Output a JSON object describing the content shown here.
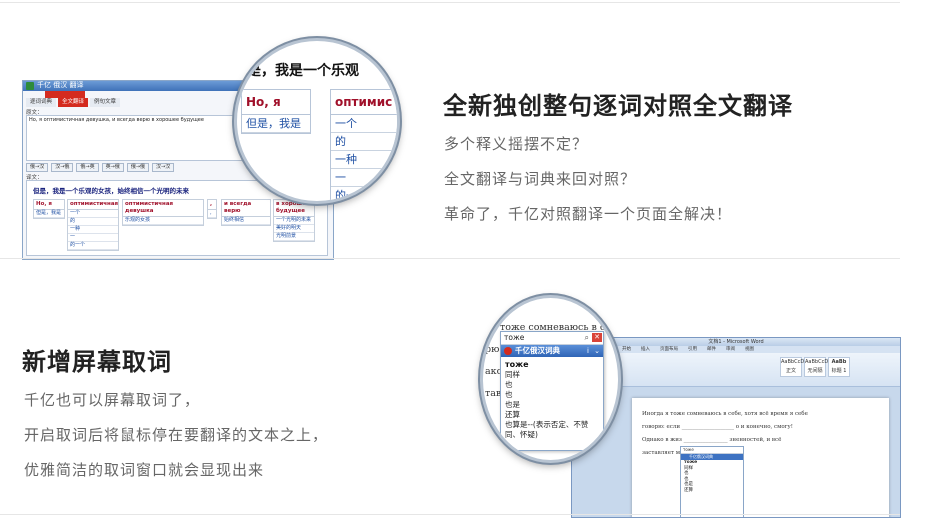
{
  "feature1": {
    "title": "全新独创整句逐词对照全文翻译",
    "desc": [
      "多个释义摇摆不定？",
      "全文翻译与词典来回对照？",
      "革命了，千亿对照翻译一个页面全解决！"
    ]
  },
  "feature2": {
    "title": "新增屏幕取词",
    "desc": [
      "千亿也可以屏幕取词了，",
      "开启取词后将鼠标停在要翻译的文本之上，",
      "优雅简洁的取词窗口就会显现出来"
    ]
  },
  "app_window": {
    "title": "千亿 俄汉 翻译",
    "tabs": [
      "逐词词典",
      "全文翻译",
      "例句文章"
    ],
    "source_label": "原文：",
    "source_text": "Но, я оптимистичная девушка, и всегда верю в хорошее будущее",
    "buttons": [
      "俄→汉",
      "汉→俄",
      "俄→英",
      "英→俄",
      "俄→俄",
      "汉→汉"
    ],
    "output_label": "译文：",
    "translation": "但是，我是一个乐观的女孩，始终相信一个光明的未来",
    "columns": [
      {
        "header": "Но, я",
        "items": [
          "但是，我是"
        ]
      },
      {
        "header": "оптимистичная",
        "items": [
          "一个",
          "的",
          "一种",
          "一",
          "的一个"
        ]
      },
      {
        "header": "оптимистичная девушка",
        "items": [
          "乐观的女孩"
        ]
      },
      {
        "header": ",",
        "items": [
          ","
        ]
      },
      {
        "header": "и всегда верю",
        "items": [
          "始终相信"
        ]
      },
      {
        "header": "в хорошее будущее",
        "items": [
          "一个光明的未来",
          "美好的明天",
          "光明前景"
        ]
      }
    ]
  },
  "magnifier1": {
    "line": "是，我是一个乐观",
    "left_header": "Но, я",
    "left_item": "但是，我是",
    "right_header": "оптимис",
    "right_items": [
      "一个",
      "的",
      "一种",
      "一",
      "的一"
    ]
  },
  "word_window": {
    "title": "文档1 - Microsoft Word",
    "tabs": [
      "开始",
      "插入",
      "页面布局",
      "引用",
      "邮件",
      "审阅",
      "视图"
    ],
    "styles": [
      "AaBbCcDd",
      "AaBbCcDd",
      "AaBb"
    ],
    "style_labels": [
      "正文",
      "无间隔",
      "标题 1"
    ],
    "lines": [
      "Иногда я тоже сомневаюсь в себе, хотя всё время я себе",
      "говорю: если ___________________ о и конечно, смогу!",
      "Однако в жиз ________________ зненностей, и всё",
      "заставляет м ___________"
    ]
  },
  "magnifier2": {
    "lines": [
      "я тоже сомневаюсь в себе, х",
      "рю: если",
      "ако в жизн",
      "тавляет ме"
    ],
    "popup": {
      "input": "тоже",
      "title": "千亿俄汉词典",
      "info": "i",
      "word": "тоже",
      "items": [
        "同样",
        "也",
        "也",
        "也是",
        "还算",
        "也算是--(表示否定、不赞同、怀疑)"
      ]
    }
  }
}
